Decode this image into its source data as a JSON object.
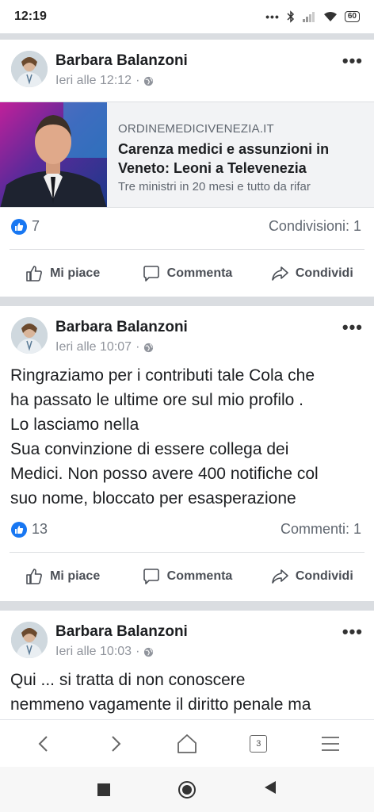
{
  "status": {
    "time": "12:19",
    "battery": "60"
  },
  "posts": [
    {
      "author": "Barbara Balanzoni",
      "time": "Ieri alle 12:12",
      "link": {
        "domain": "ORDINEMEDICIVENEZIA.IT",
        "title": "Carenza medici e assunzioni in Veneto: Leoni a Televenezia",
        "description": "Tre ministri in 20 mesi e tutto da rifar"
      },
      "likes": "7",
      "stat_right": "Condivisioni: 1"
    },
    {
      "author": "Barbara Balanzoni",
      "time": "Ieri alle 10:07",
      "text_lines": [
        "Ringraziamo per i contributi tale Cola che",
        "ha passato le ultime ore sul mio profilo .",
        "Lo lasciamo nella",
        "Sua convinzione di essere collega dei",
        "Medici. Non posso avere 400 notifiche col",
        "suo nome, bloccato per esasperazione"
      ],
      "likes": "13",
      "stat_right": "Commenti: 1"
    },
    {
      "author": "Barbara Balanzoni",
      "time": "Ieri alle 10:03",
      "text_lines": [
        "Qui ... si tratta di non conoscere",
        "nemmeno vagamente il diritto penale ma"
      ]
    }
  ],
  "actions": {
    "like": "Mi piace",
    "comment": "Commenta",
    "share": "Condividi"
  },
  "more_label": "•••",
  "browser_nav": {
    "tab_count": "3"
  },
  "colors": {
    "like_blue": "#1877f2",
    "text_gray": "#606770"
  }
}
